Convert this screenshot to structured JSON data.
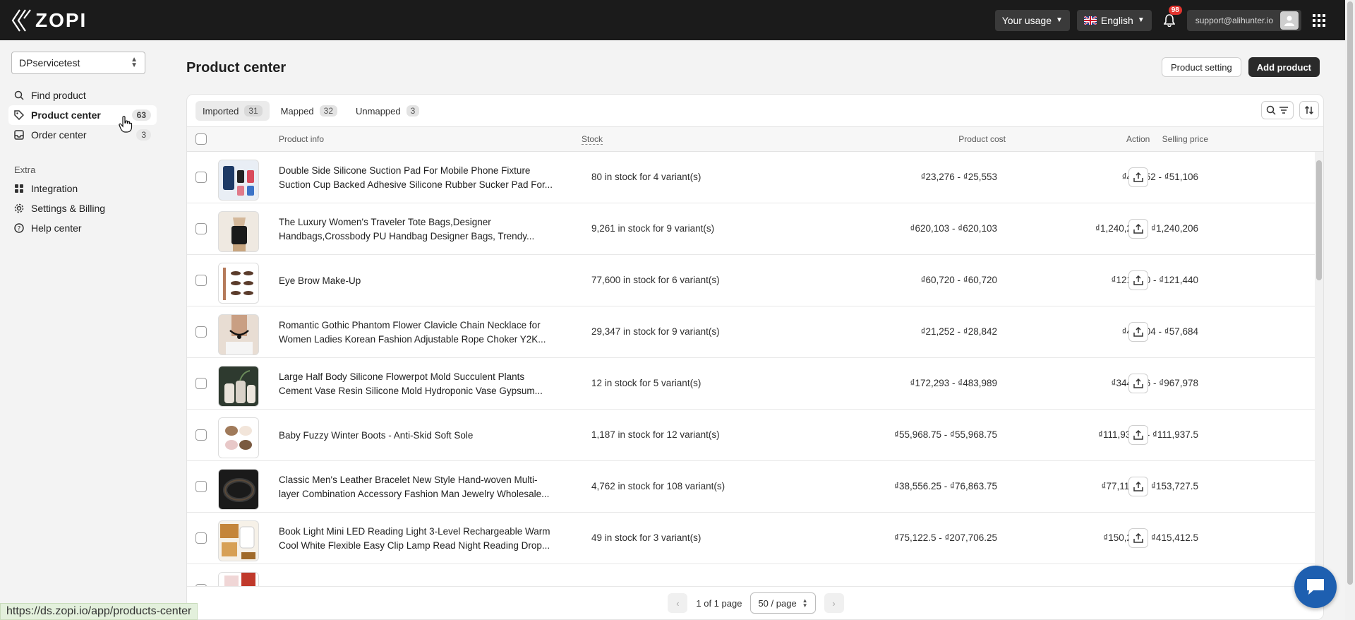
{
  "brand": {
    "name": "ZOPI"
  },
  "topbar": {
    "usage_label": "Your usage",
    "language_label": "English",
    "notification_count": "98",
    "account_email": "support@alihunter.io"
  },
  "sidebar": {
    "store_name": "DPservicetest",
    "items": [
      {
        "label": "Find product",
        "count": ""
      },
      {
        "label": "Product center",
        "count": "63"
      },
      {
        "label": "Order center",
        "count": "3"
      }
    ],
    "extra_title": "Extra",
    "extra_items": [
      {
        "label": "Integration"
      },
      {
        "label": "Settings & Billing"
      },
      {
        "label": "Help center"
      }
    ]
  },
  "page": {
    "title": "Product center",
    "product_setting_label": "Product setting",
    "add_product_label": "Add product"
  },
  "tabs": [
    {
      "label": "Imported",
      "count": "31"
    },
    {
      "label": "Mapped",
      "count": "32"
    },
    {
      "label": "Unmapped",
      "count": "3"
    }
  ],
  "table": {
    "headers": {
      "product_info": "Product info",
      "stock": "Stock",
      "product_cost": "Product cost",
      "selling_price": "Selling price",
      "action": "Action"
    },
    "rows": [
      {
        "name1": "Double Side Silicone Suction Pad For Mobile Phone Fixture",
        "name2": "Suction Cup Backed Adhesive Silicone Rubber Sucker Pad For...",
        "stock": "80 in stock for 4 variant(s)",
        "cost": "₫23,276 - ₫25,553",
        "price": "₫46,552 - ₫51,106"
      },
      {
        "name1": "The Luxury Women's Traveler Tote Bags,Designer",
        "name2": "Handbags,Crossbody PU Handbag Designer Bags, Trendy...",
        "stock": "9,261 in stock for 9 variant(s)",
        "cost": "₫620,103 - ₫620,103",
        "price": "₫1,240,206 - ₫1,240,206"
      },
      {
        "name1": "Eye Brow Make-Up",
        "name2": "",
        "stock": "77,600 in stock for 6 variant(s)",
        "cost": "₫60,720 - ₫60,720",
        "price": "₫121,440 - ₫121,440"
      },
      {
        "name1": "Romantic Gothic Phantom Flower Clavicle Chain Necklace for",
        "name2": "Women Ladies Korean Fashion Adjustable Rope Choker Y2K...",
        "stock": "29,347 in stock for 9 variant(s)",
        "cost": "₫21,252 - ₫28,842",
        "price": "₫42,504 - ₫57,684"
      },
      {
        "name1": "Large Half Body Silicone Flowerpot Mold Succulent Plants",
        "name2": "Cement Vase Resin Silicone Mold Hydroponic Vase Gypsum...",
        "stock": "12 in stock for 5 variant(s)",
        "cost": "₫172,293 - ₫483,989",
        "price": "₫344,586 - ₫967,978"
      },
      {
        "name1": "Baby Fuzzy Winter Boots - Anti-Skid Soft Sole",
        "name2": "",
        "stock": "1,187 in stock for 12 variant(s)",
        "cost": "₫55,968.75 - ₫55,968.75",
        "price": "₫111,937.5 - ₫111,937.5"
      },
      {
        "name1": "Classic Men's Leather Bracelet New Style Hand-woven Multi-",
        "name2": "layer Combination Accessory Fashion Man Jewelry Wholesale...",
        "stock": "4,762 in stock for 108 variant(s)",
        "cost": "₫38,556.25 - ₫76,863.75",
        "price": "₫77,112.5 - ₫153,727.5"
      },
      {
        "name1": "Book Light Mini LED Reading Light 3-Level Rechargeable Warm",
        "name2": "Cool White Flexible Easy Clip Lamp Read Night Reading Drop...",
        "stock": "49 in stock for 3 variant(s)",
        "cost": "₫75,122.5 - ₫207,706.25",
        "price": "₫150,245 - ₫415,412.5"
      }
    ]
  },
  "pagination": {
    "page_text": "1 of 1 page",
    "per_page": "50 / page"
  },
  "status_bar_url": "https://ds.zopi.io/app/products-center"
}
